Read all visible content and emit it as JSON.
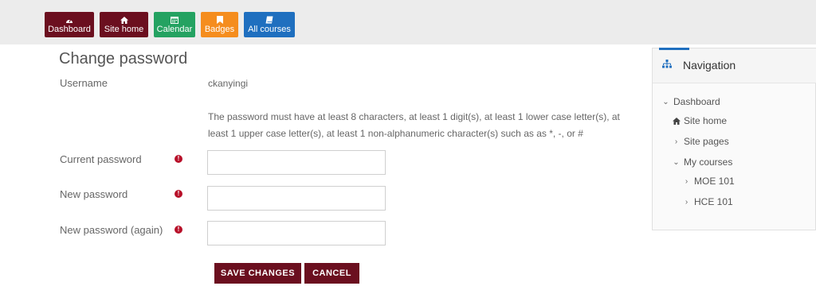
{
  "toolbar": {
    "items": [
      {
        "label": "Dashboard",
        "icon": "dashboard-icon",
        "color": "#6b0f1f"
      },
      {
        "label": "Site home",
        "icon": "home-icon",
        "color": "#6b0f1f"
      },
      {
        "label": "Calendar",
        "icon": "calendar-icon",
        "color": "#24a261"
      },
      {
        "label": "Badges",
        "icon": "bookmark-icon",
        "color": "#f58d1e"
      },
      {
        "label": "All courses",
        "icon": "book-icon",
        "color": "#1f6fbf"
      }
    ]
  },
  "form": {
    "title": "Change password",
    "username_label": "Username",
    "username_value": "ckanyingi",
    "password_policy": "The password must have at least 8 characters, at least 1 digit(s), at least 1 lower case letter(s), at least 1 upper case letter(s), at least 1 non-alphanumeric character(s) such as as *, -, or #",
    "fields": [
      {
        "label": "Current password",
        "value": ""
      },
      {
        "label": "New password",
        "value": ""
      },
      {
        "label": "New password (again)",
        "value": ""
      }
    ],
    "required_icon": "exclamation-circle-icon",
    "save_label": "SAVE CHANGES",
    "cancel_label": "CANCEL"
  },
  "navigation": {
    "title": "Navigation",
    "icon": "sitemap-icon",
    "items": [
      {
        "label": "Dashboard",
        "chevron": "down"
      },
      {
        "label": "Site home",
        "chevron": "home"
      },
      {
        "label": "Site pages",
        "chevron": "right"
      },
      {
        "label": "My courses",
        "chevron": "down"
      },
      {
        "label": "MOE 101",
        "chevron": "right"
      },
      {
        "label": "HCE 101",
        "chevron": "right"
      }
    ]
  },
  "colors": {
    "brand": "#6b0f1f",
    "calendar": "#24a261",
    "badges": "#f58d1e",
    "courses": "#1f6fbf",
    "required": "#b8102a"
  }
}
